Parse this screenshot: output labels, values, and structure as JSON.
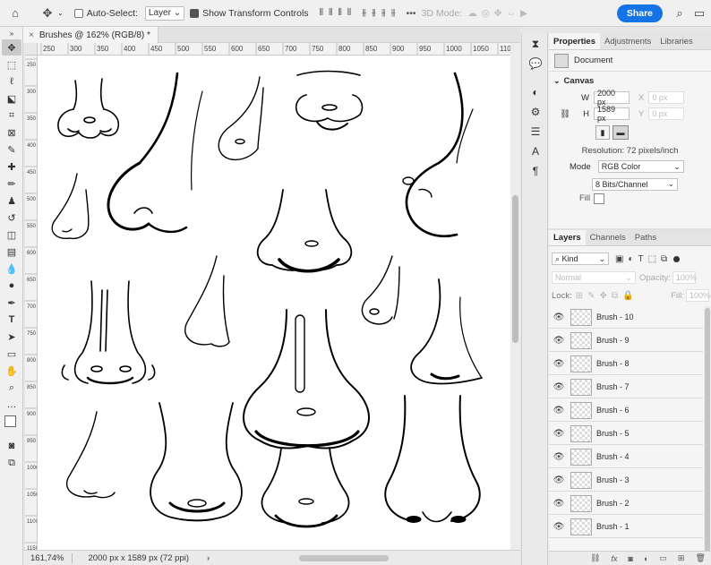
{
  "options_bar": {
    "auto_select_label": "Auto-Select:",
    "auto_select_value": "Layer",
    "show_transform_label": "Show Transform Controls",
    "mode_3d_label": "3D Mode:",
    "share_label": "Share"
  },
  "document": {
    "tab_title": "Brushes @ 162% (RGB/8) *",
    "close_glyph": "×"
  },
  "ruler": {
    "h_ticks": [
      "250",
      "300",
      "350",
      "400",
      "450",
      "500",
      "550",
      "600",
      "650",
      "700",
      "750",
      "800",
      "850",
      "900",
      "950",
      "1000",
      "1050",
      "110"
    ],
    "v_ticks": [
      "250",
      "300",
      "350",
      "400",
      "450",
      "500",
      "550",
      "600",
      "650",
      "700",
      "750",
      "800",
      "850",
      "900",
      "950",
      "1000",
      "1050",
      "1100",
      "1150"
    ]
  },
  "status": {
    "zoom": "161,74%",
    "doc_info": "2000 px x 1589 px (72 ppi)",
    "arrow": "›"
  },
  "properties": {
    "tabs": [
      "Properties",
      "Adjustments",
      "Libraries"
    ],
    "doc_label": "Document",
    "canvas_section": "Canvas",
    "w_label": "W",
    "w_value": "2000 px",
    "h_label": "H",
    "h_value": "1589 px",
    "x_label": "X",
    "x_value": "0 px",
    "y_label": "Y",
    "y_value": "0 px",
    "resolution": "Resolution: 72 pixels/inch",
    "mode_label": "Mode",
    "mode_value": "RGB Color",
    "bits_value": "8 Bits/Channel",
    "fill_label": "Fill"
  },
  "layers_panel": {
    "tabs": [
      "Layers",
      "Channels",
      "Paths"
    ],
    "kind_label": "Kind",
    "blend_mode": "Normal",
    "opacity_label": "Opacity:",
    "opacity_value": "100%",
    "lock_label": "Lock:",
    "fill_label": "Fill:",
    "fill_value": "100%",
    "layers": [
      {
        "name": "Brush - 10"
      },
      {
        "name": "Brush - 9"
      },
      {
        "name": "Brush - 8"
      },
      {
        "name": "Brush - 7"
      },
      {
        "name": "Brush - 6"
      },
      {
        "name": "Brush - 5"
      },
      {
        "name": "Brush - 4"
      },
      {
        "name": "Brush - 3"
      },
      {
        "name": "Brush - 2"
      },
      {
        "name": "Brush - 1"
      }
    ],
    "footer_icons": [
      "link-icon",
      "fx-icon",
      "mask-icon",
      "adjustment-icon",
      "group-icon",
      "new-layer-icon",
      "trash-icon"
    ]
  },
  "accent": "#1473e6"
}
